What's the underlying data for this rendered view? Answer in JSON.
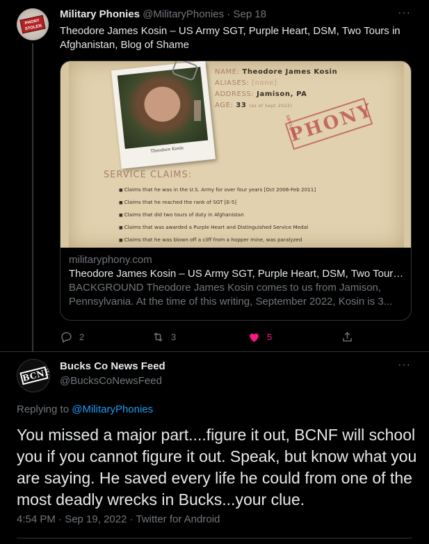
{
  "tweet1": {
    "author_name": "Military Phonies",
    "author_handle": "@MilitaryPhonies",
    "separator": " · ",
    "date": "Sep 18",
    "more": "···",
    "text": "Theodore James Kosin – US Army SGT, Purple Heart, DSM, Two Tours in Afghanistan, Blog of Shame",
    "avatar_badge": "PHONY STOLEN",
    "card": {
      "image": {
        "name_label": "NAME:",
        "name_value": "Theodore James Kosin",
        "aliases_label": "ALIASES:",
        "aliases_value": "[none]",
        "address_label": "ADDRESS:",
        "address_value": "Jamison, PA",
        "age_label": "AGE:",
        "age_value": "33",
        "age_note": "(as of Sept 2022)",
        "photo_caption": "Theodore Kosin",
        "stamp_main": "PHONY",
        "stamp_small": "MILITARY",
        "claims_title": "SERVICE CLAIMS:",
        "claims": [
          "Claims that he was in the U.S. Army for over four years [Oct 2006-Feb 2011]",
          "Claims that he reached the rank of SGT [E-5]",
          "Claims that did two tours of duty in Afghanistan",
          "Claims that was awarded a Purple Heart and Distinguished Service Medal",
          "Claims that he was blown off a cliff from a hopper mine, was paralyzed"
        ]
      },
      "domain": "militaryphony.com",
      "title": "Theodore James Kosin – US Army SGT, Purple Heart, DSM, Two Tours ...",
      "description": "BACKGROUND Theodore James Kosin comes to us from Jamison, Pennsylvania.  At the time of this writing, September 2022, Kosin is 3..."
    },
    "actions": {
      "reply_count": "2",
      "retweet_count": "3",
      "like_count": "5"
    }
  },
  "tweet2": {
    "author_name": "Bucks Co News Feed",
    "author_handle": "@BucksCoNewsFeed",
    "more": "···",
    "avatar_logo": "BCNF",
    "replying_prefix": "Replying to ",
    "replying_mention": "@MilitaryPhonies",
    "text": "You missed a major part....figure it out, BCNF will school you if you cannot figure it out.  Speak, but know what you are saying.  He saved every life he could from one of the most deadly wrecks in Bucks...your clue.",
    "footer": "4:54 PM · Sep 19, 2022 · Twitter for Android"
  },
  "colors": {
    "background": "#000000",
    "text_primary": "#e7e9ea",
    "text_secondary": "#71767b",
    "link": "#1d9bf0",
    "like": "#f91880",
    "border": "#2f3336"
  }
}
